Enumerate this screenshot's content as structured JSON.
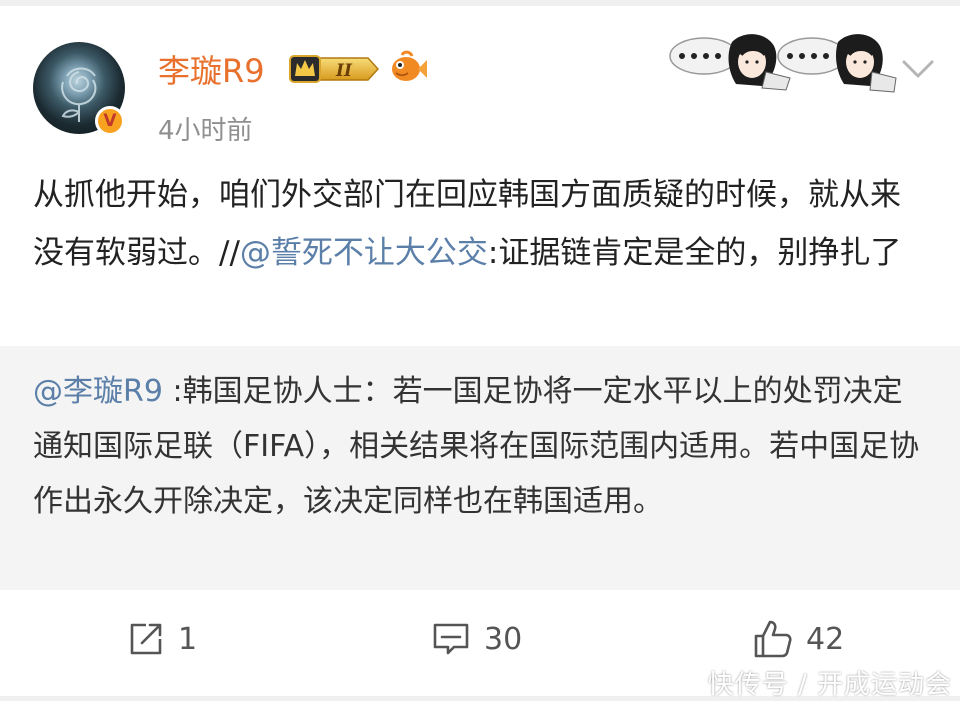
{
  "post": {
    "author": {
      "name": "李璇R9",
      "level_badge": "II",
      "verified_mark": "V",
      "avatar_icon": "dark-rose-avatar"
    },
    "timestamp": "4小时前",
    "text_main": "从抓他开始，咱们外交部门在回应韩国方面质疑的时候，就从来没有软弱过。//",
    "mention": "@誓死不让大公交",
    "text_tail": ":证据链肯定是全的，别挣扎了",
    "repost": {
      "mention": "@李璇R9",
      "text": " :韩国足协人士：若一国足协将一定水平以上的处罚决定通知国际足联（FIFA），相关结果将在国际范围内适用。若中国足协作出永久开除决定，该决定同样也在韩国适用。"
    }
  },
  "actions": {
    "share_count": "1",
    "comment_count": "30",
    "like_count": "42"
  },
  "watermark": "快传号 / 开成运动会",
  "colors": {
    "username": "#e8712e",
    "mention": "#5b7fa8",
    "timestamp": "#8f8f8f",
    "quote_bg": "#f4f4f4"
  }
}
